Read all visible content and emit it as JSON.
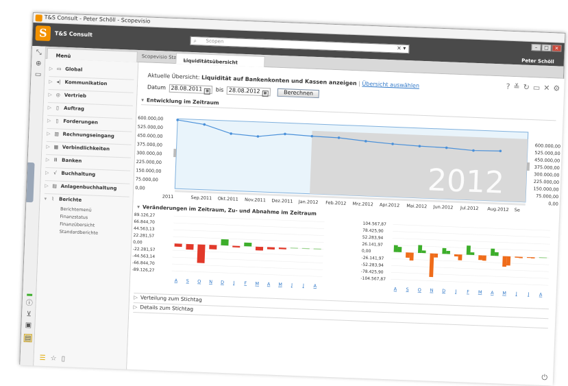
{
  "window": {
    "title": "T&S Consult - Peter Schöll - Scopevisio"
  },
  "header": {
    "logo_letter": "S",
    "company": "T&S Consult",
    "search_placeholder": "Scopen",
    "user": "Peter Schöll"
  },
  "tabs": {
    "menu_label": "Menü",
    "start_label": "Scopevisio Start",
    "active_label": "Liquiditätsübersicht"
  },
  "sidebar": {
    "items": [
      {
        "label": "Global",
        "icon": "monitor-icon"
      },
      {
        "label": "Kommunikation",
        "icon": "communication-icon"
      },
      {
        "label": "Vertrieb",
        "icon": "target-icon"
      },
      {
        "label": "Auftrag",
        "icon": "document-icon"
      },
      {
        "label": "Forderungen",
        "icon": "document-icon"
      },
      {
        "label": "Rechnungseingang",
        "icon": "invoice-icon"
      },
      {
        "label": "Verbindlichkeiten",
        "icon": "payables-icon"
      },
      {
        "label": "Banken",
        "icon": "bank-icon"
      },
      {
        "label": "Buchhaltung",
        "icon": "chart-icon"
      },
      {
        "label": "Anlagenbuchhaltung",
        "icon": "assets-icon"
      },
      {
        "label": "Berichte",
        "icon": "reports-icon"
      }
    ],
    "sub_items": [
      "Berichtemenü",
      "Finanzstatus",
      "Finanzübersicht",
      "Standardberichte"
    ],
    "rail_label": "Menü"
  },
  "main": {
    "overview_prefix": "Aktuelle Übersicht:",
    "overview_bold": "Liquidität auf Bankenkonten und Kassen anzeigen",
    "overview_sep": "|",
    "overview_link": "Übersicht auswählen",
    "date_label": "Datum",
    "date_from": "28.08.2011",
    "date_to_label": "bis",
    "date_to": "28.08.2012",
    "compute_button": "Berechnen",
    "section_trend": "Entwicklung im Zeitraum",
    "section_changes": "Veränderungen im Zeitraum, Zu- und Abnahme im Zeitraum",
    "section_distribution": "Verteilung zum Stichtag",
    "section_details": "Details zum Stichtag",
    "year_watermark": "2012"
  },
  "chart_data": [
    {
      "type": "line",
      "title": "",
      "x": [
        "2011",
        "Sep.2011",
        "Okt.2011",
        "Nov.2011",
        "Dez.2011",
        "Jan.2012",
        "Feb.2012",
        "Mrz.2012",
        "Apr.2012",
        "Mai.2012",
        "Jun.2012",
        "Jul.2012",
        "Aug.2012",
        "Se"
      ],
      "series": [
        {
          "values": [
            590000,
            560000,
            490000,
            475000,
            505000,
            495000,
            490000,
            470000,
            455000,
            445000,
            440000,
            425000,
            430000
          ]
        }
      ],
      "y_ticks_left": [
        "600.000,00",
        "525.000,00",
        "450.000,00",
        "375.000,00",
        "300.000,00",
        "225.000,00",
        "150.000,00",
        "75.000,00",
        "0,00"
      ],
      "y_ticks_right": [
        "600.000,00",
        "525.000,00",
        "450.000,00",
        "375.000,00",
        "300.000,00",
        "225.000,00",
        "150.000,00",
        "75.000,00",
        "0,00"
      ],
      "ylim": [
        0,
        600000
      ],
      "grid": false,
      "colors": {
        "line": "#4a90d9",
        "highlight": "#e9f4fb",
        "future": "#d9d9d9"
      }
    },
    {
      "type": "bar",
      "title": "",
      "categories": [
        "A",
        "S",
        "O",
        "N",
        "D",
        "J",
        "F",
        "M",
        "A",
        "M",
        "J",
        "J",
        "A"
      ],
      "values": [
        -10000,
        -18000,
        -60000,
        -14000,
        20000,
        -5000,
        12000,
        -12000,
        -7000,
        -5000,
        0,
        0,
        0
      ],
      "y_ticks": [
        "89.126,27",
        "66.844,70",
        "44.563,13",
        "22.281,57",
        "0,00",
        "-22.281,57",
        "-44.563,14",
        "-66.844,70",
        "-89.126,27"
      ],
      "ylim": [
        -89126.27,
        89126.27
      ],
      "colors": {
        "positive": "#3dae2b",
        "negative": "#e2392a"
      }
    },
    {
      "type": "bar",
      "title": "",
      "categories": [
        "A",
        "S",
        "O",
        "N",
        "D",
        "J",
        "F",
        "M",
        "A",
        "M",
        "J",
        "J",
        "A"
      ],
      "series": [
        {
          "values": [
            26000,
            -20000,
            30000,
            -90000,
            22000,
            -8000,
            35000,
            -18000,
            27000,
            -40000,
            -4000,
            -3000,
            -2000
          ]
        },
        {
          "values": [
            20000,
            -30000,
            10000,
            -15000,
            12000,
            -22000,
            10000,
            -20000,
            14000,
            -35000,
            -5000,
            -4000,
            -2000
          ]
        }
      ],
      "y_ticks": [
        "104.567,87",
        "78.425,90",
        "52.283,94",
        "26.141,97",
        "0,00",
        "-26.141,97",
        "-52.283,94",
        "-78.425,90",
        "-104.567,87"
      ],
      "ylim": [
        -104567.87,
        104567.87
      ],
      "colors": {
        "positive": "#3dae2b",
        "negative": "#ef6c1a"
      }
    }
  ]
}
